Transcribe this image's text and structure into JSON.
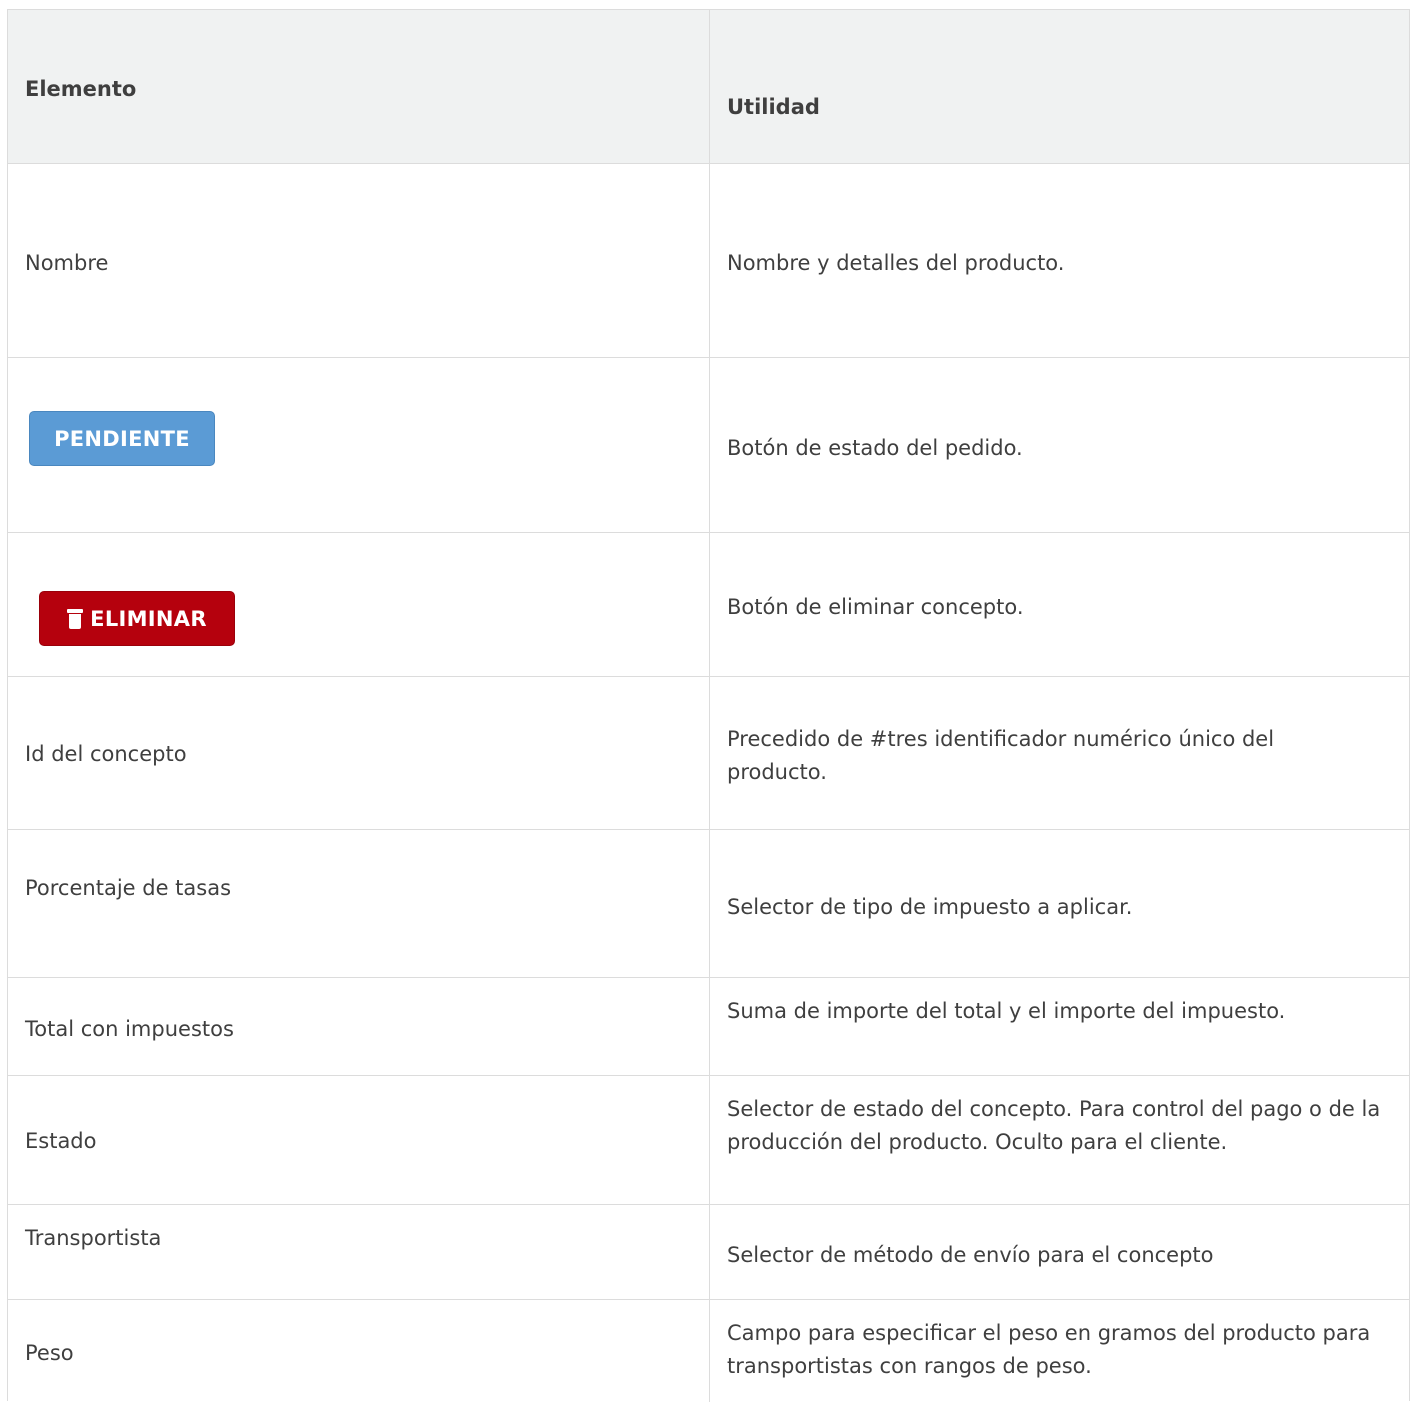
{
  "header": {
    "col1": "Elemento",
    "col2": "Utilidad"
  },
  "rows": [
    {
      "element": "Nombre",
      "utility": "Nombre y detalles del producto."
    },
    {
      "element_button": "PENDIENTE",
      "utility": "Botón de estado del pedido."
    },
    {
      "element_button": "ELIMINAR",
      "element_icon": "trash-icon",
      "utility": "Botón de eliminar concepto."
    },
    {
      "element": "Id del concepto",
      "utility": "Precedido de #tres identificador numérico único del producto."
    },
    {
      "element": "Porcentaje de tasas",
      "utility": "Selector de tipo de impuesto a aplicar."
    },
    {
      "element": "Total con impuestos",
      "utility": "Suma de importe del total y el importe del impuesto."
    },
    {
      "element": "Estado",
      "utility": "Selector de estado del concepto. Para control del pago o de la producción del producto. Oculto para el cliente."
    },
    {
      "element": "Transportista",
      "utility": "Selector de método de envío para el concepto"
    },
    {
      "element": "Peso",
      "utility": "Campo para especificar el peso en gramos del producto para transportistas con rangos de peso."
    }
  ],
  "colors": {
    "header_bg": "#f0f2f2",
    "border": "#dcdcdc",
    "pendiente_button": "#5b9bd5",
    "eliminar_button": "#b5010d",
    "text": "#3f3f3f"
  }
}
